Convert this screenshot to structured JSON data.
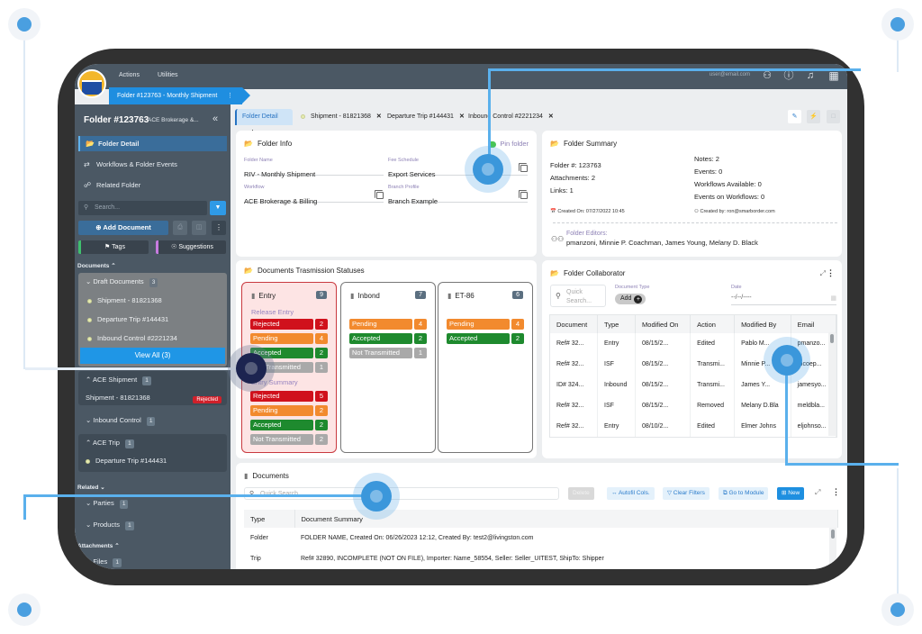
{
  "topbar": {
    "menu": [
      "Actions",
      "Utilities"
    ],
    "user_email": "user@email.com",
    "breadcrumb": "Folder #123763 - Monthly Shipment"
  },
  "sidebar": {
    "title": "Folder #123763",
    "subtitle": "ACE Brokerage &...",
    "nav": [
      {
        "label": "Folder Detail",
        "icon": "folder-open-icon",
        "active": true
      },
      {
        "label": "Workflows & Folder Events",
        "icon": "workflow-icon"
      },
      {
        "label": "Related Folder",
        "icon": "related-icon"
      }
    ],
    "search_placeholder": "Search...",
    "add_document": "Add Document",
    "tags": "Tags",
    "suggestions": "Suggestions",
    "documents_label": "Documents",
    "draft": {
      "label": "Draft Documents",
      "count": "3",
      "items": [
        "Shipment - 81821368",
        "Departure Trip #144431",
        "Inbound Control #2221234"
      ],
      "view_all": "View All (3)"
    },
    "ace_shipment": {
      "label": "ACE Shipment",
      "count": "1",
      "item": "Shipment - 81821368",
      "badge": "Rejected"
    },
    "inbound_control": {
      "label": "Inbound Control",
      "count": "1"
    },
    "ace_trip": {
      "label": "ACE Trip",
      "count": "1",
      "item": "Departure Trip #144431"
    },
    "related_label": "Related",
    "parties": {
      "label": "Parties",
      "count": "1"
    },
    "products": {
      "label": "Products",
      "count": "1"
    },
    "attachments_label": "Attachments",
    "files": {
      "label": "Files",
      "count": "1"
    }
  },
  "tabs": [
    {
      "label": "Folder Detail",
      "active": true
    },
    {
      "label": "Shipment - 81821368"
    },
    {
      "label": "Departure Trip #144431"
    },
    {
      "label": "Inbound Control #2221234"
    }
  ],
  "folder_info": {
    "title": "Folder Info",
    "pin": "Pin folder",
    "fields": [
      {
        "label": "Folder Name",
        "value": "RIV - Monthly Shipment"
      },
      {
        "label": "Fee Schedule",
        "value": "Export Services"
      },
      {
        "label": "Workflow",
        "value": "ACE Brokerage & Billing"
      },
      {
        "label": "Branch Profile",
        "value": "Branch Example"
      }
    ]
  },
  "folder_summary": {
    "title": "Folder Summary",
    "left": [
      "Folder #: 123763",
      "Attachments: 2",
      "Links: 1"
    ],
    "right": [
      "Notes: 2",
      "Events: 0",
      "Workflows Available: 0",
      "Events on Workflows: 0"
    ],
    "created_on": "Created On: 07/27/2022 10:45",
    "created_by": "Created by: ron@smarborder.com",
    "editors_label": "Folder Editors:",
    "editors": "pmanzoni, Minnie P. Coachman, James Young, Melany D. Black"
  },
  "transmission": {
    "title": "Documents Trasmission Statuses",
    "boxes": [
      {
        "name": "Entry",
        "total": "9",
        "groups": [
          {
            "label": "Release Entry",
            "rows": [
              [
                "Rejected",
                "2"
              ],
              [
                "Pending",
                "4"
              ],
              [
                "Accepted",
                "2"
              ],
              [
                "Not Transmitted",
                "1"
              ]
            ]
          },
          {
            "label": "Entry Summary",
            "rows": [
              [
                "Rejected",
                "5"
              ],
              [
                "Pending",
                "2"
              ],
              [
                "Accepted",
                "2"
              ],
              [
                "Not Transmitted",
                "2"
              ]
            ]
          }
        ]
      },
      {
        "name": "Inbond",
        "total": "7",
        "rows": [
          [
            "Pending",
            "4"
          ],
          [
            "Accepted",
            "2"
          ],
          [
            "Not Transmitted",
            "1"
          ]
        ]
      },
      {
        "name": "ET-86",
        "total": "6",
        "rows": [
          [
            "Pending",
            "4"
          ],
          [
            "Accepted",
            "2"
          ]
        ]
      }
    ]
  },
  "collaborator": {
    "title": "Folder Collaborator",
    "search_placeholder": "Quick Search...",
    "doc_type_label": "Document Type",
    "add_chip": "Add",
    "date_label": "Date",
    "date_value": "--/--/----",
    "columns": [
      "Document",
      "Type",
      "Modified On",
      "Action",
      "Modified By",
      "Email"
    ],
    "rows": [
      [
        "Ref# 32...",
        "Entry",
        "08/15/2...",
        "Edited",
        "Pablo M...",
        "pmanzo..."
      ],
      [
        "Ref# 32...",
        "ISF",
        "08/15/2...",
        "Transmi...",
        "Minnie P...",
        "mcoep..."
      ],
      [
        "ID# 324...",
        "Inbound",
        "08/15/2...",
        "Transmi...",
        "James Y...",
        "jamesyo..."
      ],
      [
        "Ref# 32...",
        "ISF",
        "08/15/2...",
        "Removed",
        "Melany D.Bla",
        "meldbla..."
      ],
      [
        "Ref# 32...",
        "Entry",
        "08/10/2...",
        "Edited",
        "Elmer Johns",
        "eljohnso..."
      ]
    ]
  },
  "documents": {
    "title": "Documents",
    "search_placeholder": "Quick Search",
    "buttons": {
      "delete": "Delete",
      "autofit": "↔ Autofil Cols.",
      "clear": "▽ Clear Filters",
      "goto": "⧉ Go to Module",
      "new": "⊞ New"
    },
    "columns": [
      "Type",
      "Document Summary"
    ],
    "rows": [
      [
        "Folder",
        "FOLDER NAME, Created On: 06/26/2023 12:12, Created By: test2@livingston.com"
      ],
      [
        "Trip",
        "Ref# 32890, INCOMPLETE (NOT ON FILE), Importer: Name_58554, Seller: Seller_UITEST, ShipTo: Shipper"
      ]
    ]
  },
  "colors": {
    "accent": "#1f8ee0",
    "rejected": "#d0111c",
    "pending": "#f28a2e",
    "accepted": "#1e8a2e",
    "not_transmitted": "#a9a9a9"
  }
}
